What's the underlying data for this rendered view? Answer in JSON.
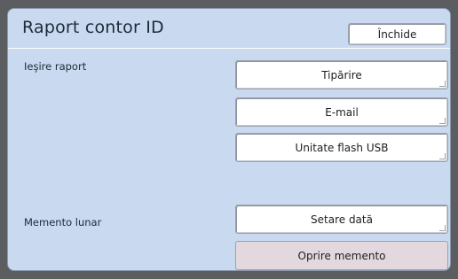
{
  "header": {
    "title": "Raport contor ID",
    "close_label": "Închide"
  },
  "report_output": {
    "label": "Ieşire raport",
    "buttons": [
      "Tipărire",
      "E-mail",
      "Unitate flash USB"
    ]
  },
  "monthly_reminder": {
    "label": "Memento lunar",
    "set_date_label": "Setare dată",
    "stop_reminder_label": "Oprire memento"
  }
}
